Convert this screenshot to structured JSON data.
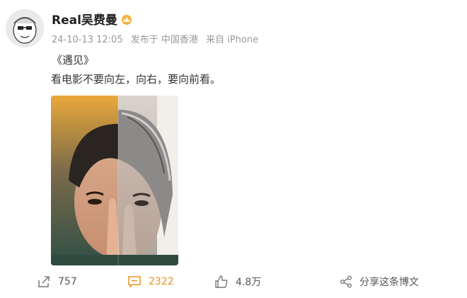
{
  "post": {
    "username": "Real吴费曼",
    "meta": {
      "date": "24-10-13 12:05",
      "location": "发布于 中国香港",
      "source": "来自 iPhone"
    },
    "title": "《遇见》",
    "body": "看电影不要向左，向右，要向前看。"
  },
  "actions": {
    "repost_count": "757",
    "comment_count": "2322",
    "like_count": "4.8万",
    "share_label": "分享这条博文"
  },
  "colors": {
    "comment_active": "#e8931f",
    "text_muted": "#999999"
  }
}
